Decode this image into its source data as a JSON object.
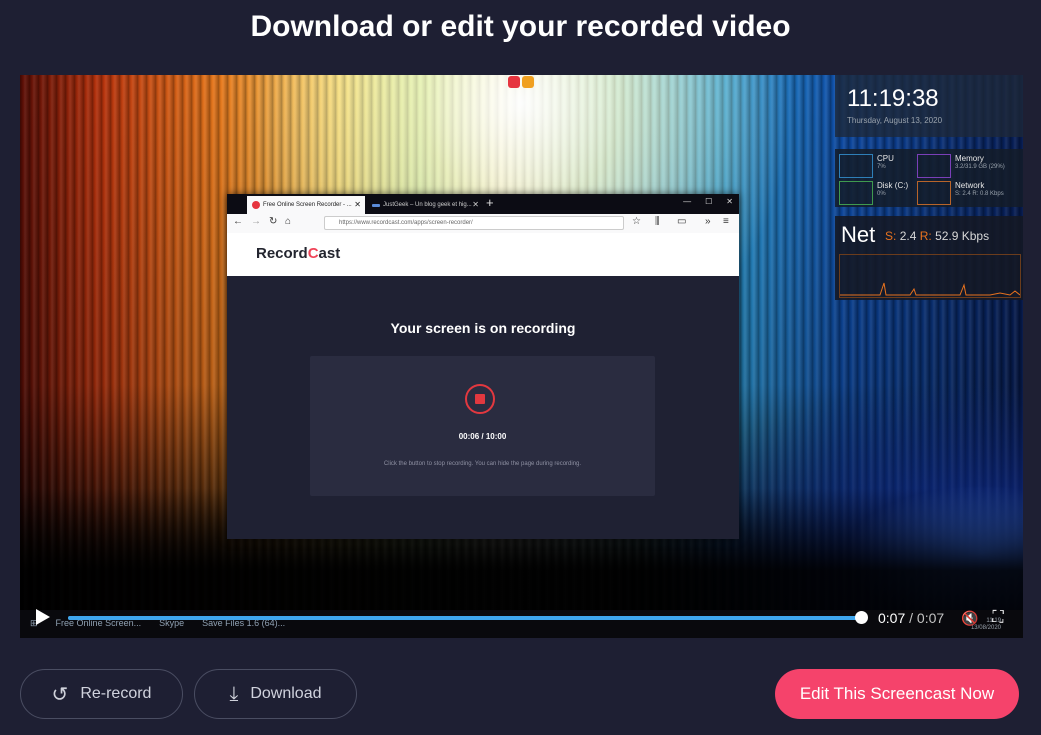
{
  "page": {
    "title": "Download or edit your recorded video"
  },
  "video": {
    "desktop_widgets": {
      "clock_time": "11:19:38",
      "clock_date": "Thursday, August 13, 2020",
      "cpu_label": "CPU",
      "cpu_value": "7%",
      "memory_label": "Memory",
      "memory_value": "3.2/31.9 GB (29%)",
      "disk_label": "Disk (C:)",
      "disk_value": "0%",
      "network_label": "Network",
      "network_value": "S: 2.4 R: 0.8 Kbps",
      "net_title": "Net",
      "net_s_key": "S:",
      "net_s_value": "2.4",
      "net_r_key": "R:",
      "net_r_value": "52.9 Kbps"
    },
    "browser": {
      "tabs": [
        "Free Online Screen Recorder - ...",
        "JustGeek – Un blog geek et hig..."
      ],
      "new_tab": "+",
      "url": "https://www.recordcast.com/apps/screen-recorder/",
      "logo_part1": "Record",
      "logo_dot": "C",
      "logo_part2": "ast",
      "recording_title": "Your screen is on recording",
      "recording_time": "00:06 / 10:00",
      "recording_hint": "Click the button to stop recording. You can hide the page during recording."
    },
    "taskbar": {
      "items": [
        "Free Online Screen...",
        "Skype",
        "Save Files 1.6 (64)..."
      ],
      "clock_time": "11:19",
      "clock_date": "13/08/2020"
    },
    "player": {
      "current_time": "0:07",
      "separator": " / ",
      "duration": "0:07",
      "progress_fraction": 1.0
    }
  },
  "actions": {
    "rerecord_label": "Re-record",
    "download_label": "Download",
    "edit_label": "Edit This Screencast Now"
  },
  "colors": {
    "accent": "#f5436b",
    "progress": "#3ea6ee",
    "background": "#1e1f33"
  }
}
